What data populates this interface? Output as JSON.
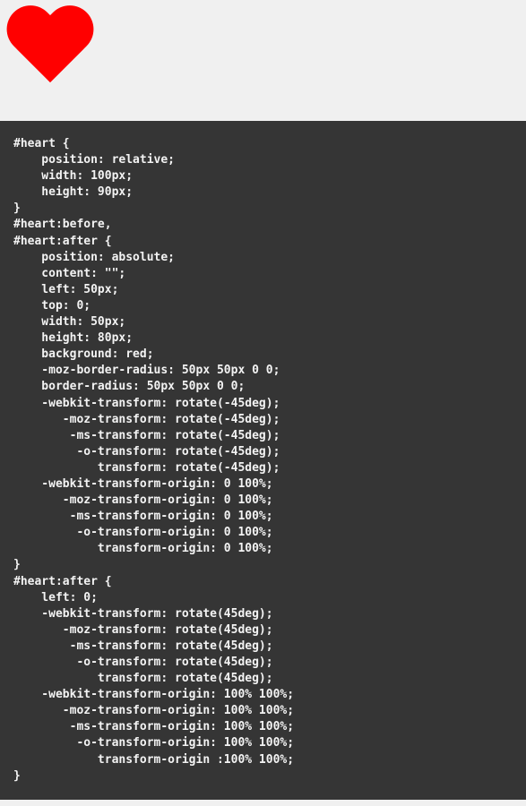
{
  "preview": {
    "shape_name": "heart",
    "heart_color": "#ff0000",
    "background_color": "#f0f0f0"
  },
  "code_panel": {
    "background_color": "#353535",
    "text_color": "#f3f3f3",
    "lines": [
      "#heart {",
      "    position: relative;",
      "    width: 100px;",
      "    height: 90px;",
      "}",
      "#heart:before,",
      "#heart:after {",
      "    position: absolute;",
      "    content: \"\";",
      "    left: 50px;",
      "    top: 0;",
      "    width: 50px;",
      "    height: 80px;",
      "    background: red;",
      "    -moz-border-radius: 50px 50px 0 0;",
      "    border-radius: 50px 50px 0 0;",
      "    -webkit-transform: rotate(-45deg);",
      "       -moz-transform: rotate(-45deg);",
      "        -ms-transform: rotate(-45deg);",
      "         -o-transform: rotate(-45deg);",
      "            transform: rotate(-45deg);",
      "    -webkit-transform-origin: 0 100%;",
      "       -moz-transform-origin: 0 100%;",
      "        -ms-transform-origin: 0 100%;",
      "         -o-transform-origin: 0 100%;",
      "            transform-origin: 0 100%;",
      "}",
      "#heart:after {",
      "    left: 0;",
      "    -webkit-transform: rotate(45deg);",
      "       -moz-transform: rotate(45deg);",
      "        -ms-transform: rotate(45deg);",
      "         -o-transform: rotate(45deg);",
      "            transform: rotate(45deg);",
      "    -webkit-transform-origin: 100% 100%;",
      "       -moz-transform-origin: 100% 100%;",
      "        -ms-transform-origin: 100% 100%;",
      "         -o-transform-origin: 100% 100%;",
      "            transform-origin :100% 100%;",
      "}"
    ]
  }
}
